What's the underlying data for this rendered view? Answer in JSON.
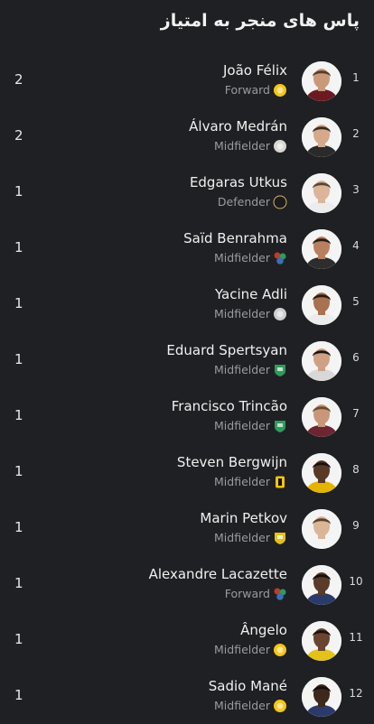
{
  "header": {
    "title": "پاس های منجر به امتیاز"
  },
  "players": [
    {
      "rank": "1",
      "name": "João Félix",
      "position": "Forward",
      "score": "2",
      "club_icon": "al-nassr-badge",
      "club_color": "#f5c518",
      "skin": "#c99a7a",
      "hair": "#5a3b22",
      "shirt": "#6b1a22"
    },
    {
      "rank": "2",
      "name": "Álvaro Medrán",
      "position": "Midfielder",
      "score": "2",
      "club_icon": "al-taawoun-badge",
      "club_color": "#d8d8d0",
      "skin": "#d6a98a",
      "hair": "#3b2a1e",
      "shirt": "#2a2a2a"
    },
    {
      "rank": "3",
      "name": "Edgaras Utkus",
      "position": "Defender",
      "score": "1",
      "club_icon": "black-badge",
      "club_color": "#1b1b1b",
      "skin": "#dcb49a",
      "hair": "#5b4632",
      "shirt": "#ececec"
    },
    {
      "rank": "4",
      "name": "Saïd Benrahma",
      "position": "Midfielder",
      "score": "1",
      "club_icon": "multi-club-icon",
      "club_color": "#3b6fb6",
      "skin": "#b98060",
      "hair": "#2a1c14",
      "shirt": "#2d2d2d"
    },
    {
      "rank": "5",
      "name": "Yacine Adli",
      "position": "Midfielder",
      "score": "1",
      "club_icon": "al-shabab-badge",
      "club_color": "#cfcfcf",
      "skin": "#a8714f",
      "hair": "#2b1a10",
      "shirt": "#ececec"
    },
    {
      "rank": "6",
      "name": "Eduard Spertsyan",
      "position": "Midfielder",
      "score": "1",
      "club_icon": "green-shield-badge",
      "club_color": "#2f9b5a",
      "skin": "#d0a084",
      "hair": "#1e1510",
      "shirt": "#d8d8d8"
    },
    {
      "rank": "7",
      "name": "Francisco Trincão",
      "position": "Midfielder",
      "score": "1",
      "club_icon": "green-shield-badge",
      "club_color": "#2f9b5a",
      "skin": "#c8977a",
      "hair": "#6b4a2b",
      "shirt": "#6b2533"
    },
    {
      "rank": "8",
      "name": "Steven Bergwijn",
      "position": "Midfielder",
      "score": "1",
      "club_icon": "al-ittihad-badge",
      "club_color": "#f1c40f",
      "skin": "#5a3826",
      "hair": "#1a110c",
      "shirt": "#e3b400"
    },
    {
      "rank": "9",
      "name": "Marin Petkov",
      "position": "Midfielder",
      "score": "1",
      "club_icon": "yellow-shield-badge",
      "club_color": "#e0c21b",
      "skin": "#dab597",
      "hair": "#5d4128",
      "shirt": "#f4f4f4"
    },
    {
      "rank": "10",
      "name": "Alexandre Lacazette",
      "position": "Forward",
      "score": "1",
      "club_icon": "multi-club-icon",
      "club_color": "#3b6fb6",
      "skin": "#5a3a28",
      "hair": "#160f0a",
      "shirt": "#2a3a6a"
    },
    {
      "rank": "11",
      "name": "Ângelo",
      "position": "Midfielder",
      "score": "1",
      "club_icon": "al-nassr-badge",
      "club_color": "#f5c518",
      "skin": "#6a4430",
      "hair": "#1a110c",
      "shirt": "#e3c21a"
    },
    {
      "rank": "12",
      "name": "Sadio Mané",
      "position": "Midfielder",
      "score": "1",
      "club_icon": "al-nassr-badge",
      "club_color": "#f5c518",
      "skin": "#3e281c",
      "hair": "#140d08",
      "shirt": "#2a3a6a"
    }
  ]
}
